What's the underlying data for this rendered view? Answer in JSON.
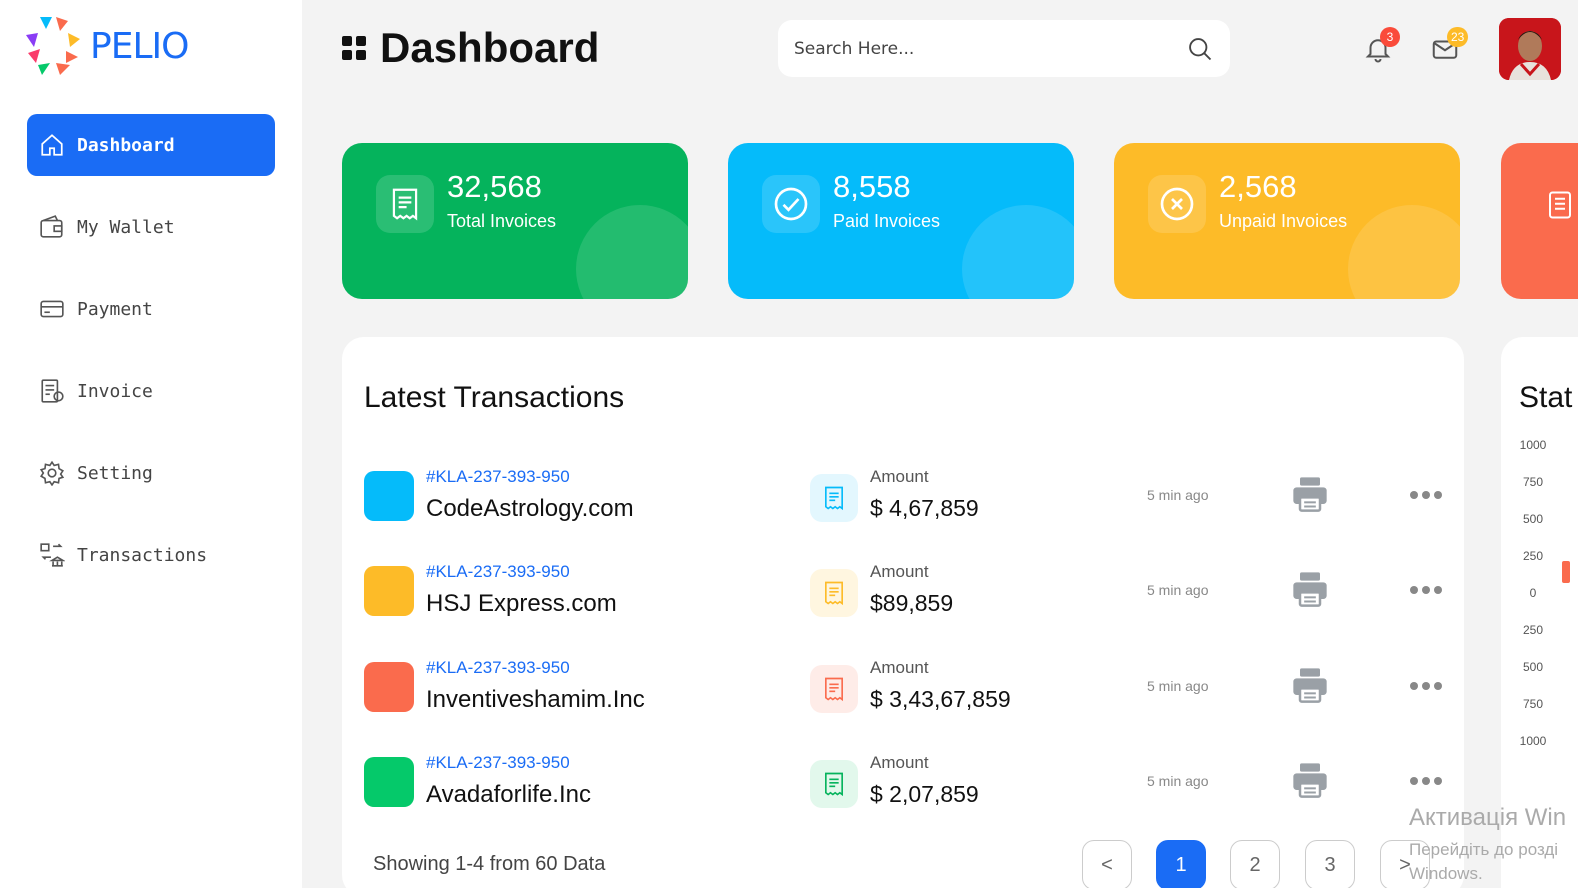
{
  "brand": {
    "name": "PELIO"
  },
  "sidebar": {
    "items": [
      {
        "label": "Dashboard",
        "icon": "home-icon"
      },
      {
        "label": "My Wallet",
        "icon": "wallet-icon"
      },
      {
        "label": "Payment",
        "icon": "credit-card-icon"
      },
      {
        "label": "Invoice",
        "icon": "invoice-icon"
      },
      {
        "label": "Setting",
        "icon": "gear-icon"
      },
      {
        "label": "Transactions",
        "icon": "bank-transfer-icon"
      }
    ]
  },
  "header": {
    "title": "Dashboard",
    "search_placeholder": "Search Here...",
    "notifications_count": "3",
    "messages_count": "23"
  },
  "stats": [
    {
      "value": "32,568",
      "label": "Total Invoices",
      "color": "#05b35c",
      "icon": "receipt-icon"
    },
    {
      "value": "8,558",
      "label": "Paid Invoices",
      "color": "#05bbfa",
      "icon": "check-circle-icon"
    },
    {
      "value": "2,568",
      "label": "Unpaid Invoices",
      "color": "#fdbb28",
      "icon": "x-circle-icon"
    }
  ],
  "transactions": {
    "title": "Latest Transactions",
    "amount_label": "Amount",
    "rows": [
      {
        "id": "#KLA-237-393-950",
        "name": "CodeAstrology.com",
        "amount": "$ 4,67,859",
        "time": "5 min ago",
        "color": "#05bbfa"
      },
      {
        "id": "#KLA-237-393-950",
        "name": "HSJ Express.com",
        "amount": "$89,859",
        "time": "5 min ago",
        "color": "#fdbb28"
      },
      {
        "id": "#KLA-237-393-950",
        "name": "Inventiveshamim.Inc",
        "amount": "$ 3,43,67,859",
        "time": "5 min ago",
        "color": "#fa6b4d"
      },
      {
        "id": "#KLA-237-393-950",
        "name": "Avadaforlife.Inc",
        "amount": "$ 2,07,859",
        "time": "5 min ago",
        "color": "#05c96a"
      }
    ],
    "showing": "Showing 1-4 from 60 Data",
    "pagination": [
      "<",
      "1",
      "2",
      "3",
      ">"
    ]
  },
  "statistics": {
    "title": "Stat",
    "ticks": [
      "1000",
      "750",
      "500",
      "250",
      "0",
      "250",
      "500",
      "750",
      "1000"
    ]
  },
  "watermark": {
    "line1": "Активація Win",
    "line2": "Перейдіть до розді",
    "line3": "Windows."
  }
}
